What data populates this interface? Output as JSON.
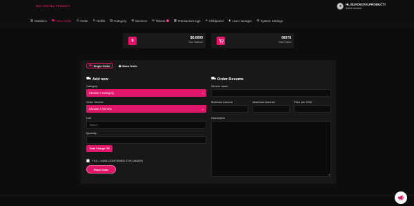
{
  "brand": {
    "name": "BUY DIGITAL PRODUCT"
  },
  "user": {
    "greeting": "Hi, BUYDIGITALPRODUCT!",
    "role": "Admin account"
  },
  "nav": [
    {
      "label": "Statistics",
      "icon": "chart-icon"
    },
    {
      "label": "New Order",
      "icon": "cart-icon",
      "active": true
    },
    {
      "label": "Order",
      "icon": "list-icon"
    },
    {
      "label": "Refills",
      "icon": "refresh-icon"
    },
    {
      "label": "Category",
      "icon": "folder-icon"
    },
    {
      "label": "Services",
      "icon": "gear-icon"
    },
    {
      "label": "Tickets",
      "icon": "ticket-icon",
      "badge": "0"
    },
    {
      "label": "Transaction logs",
      "icon": "log-icon"
    },
    {
      "label": "Childpanel",
      "icon": "link-icon"
    },
    {
      "label": "User manager",
      "icon": "users-icon"
    },
    {
      "label": "System Settings",
      "icon": "settings-icon"
    }
  ],
  "stats": {
    "balance": {
      "icon": "$",
      "value": "$0.0000",
      "label": "Your Balance"
    },
    "orders": {
      "icon": "cart-icon",
      "value": "68378",
      "label": "Total Orders"
    }
  },
  "tabs": {
    "single": "Single Order",
    "mass": "Mass Order"
  },
  "form": {
    "title": "Add new",
    "category_label": "Category",
    "category_value": "Choose A Category",
    "service_label": "Order Service",
    "service_value": "Choose A Service",
    "link_label": "Link",
    "link_placeholder": "https://",
    "quantity_label": "Quantity",
    "charge_label": "Total Charge: $0",
    "confirm_label": "YES, I HAVE CONFIRMED THE ORDER!",
    "submit_label": "Place order"
  },
  "resume": {
    "title": "Order Resume",
    "service_name_label": "Service name",
    "min_label": "Minimum Amount",
    "max_label": "Maximum Amount",
    "price_label": "Price per 1000",
    "description_label": "Description"
  },
  "colors": {
    "accent": "#e0166b",
    "background": "#0d0d0d",
    "card": "#181818"
  }
}
